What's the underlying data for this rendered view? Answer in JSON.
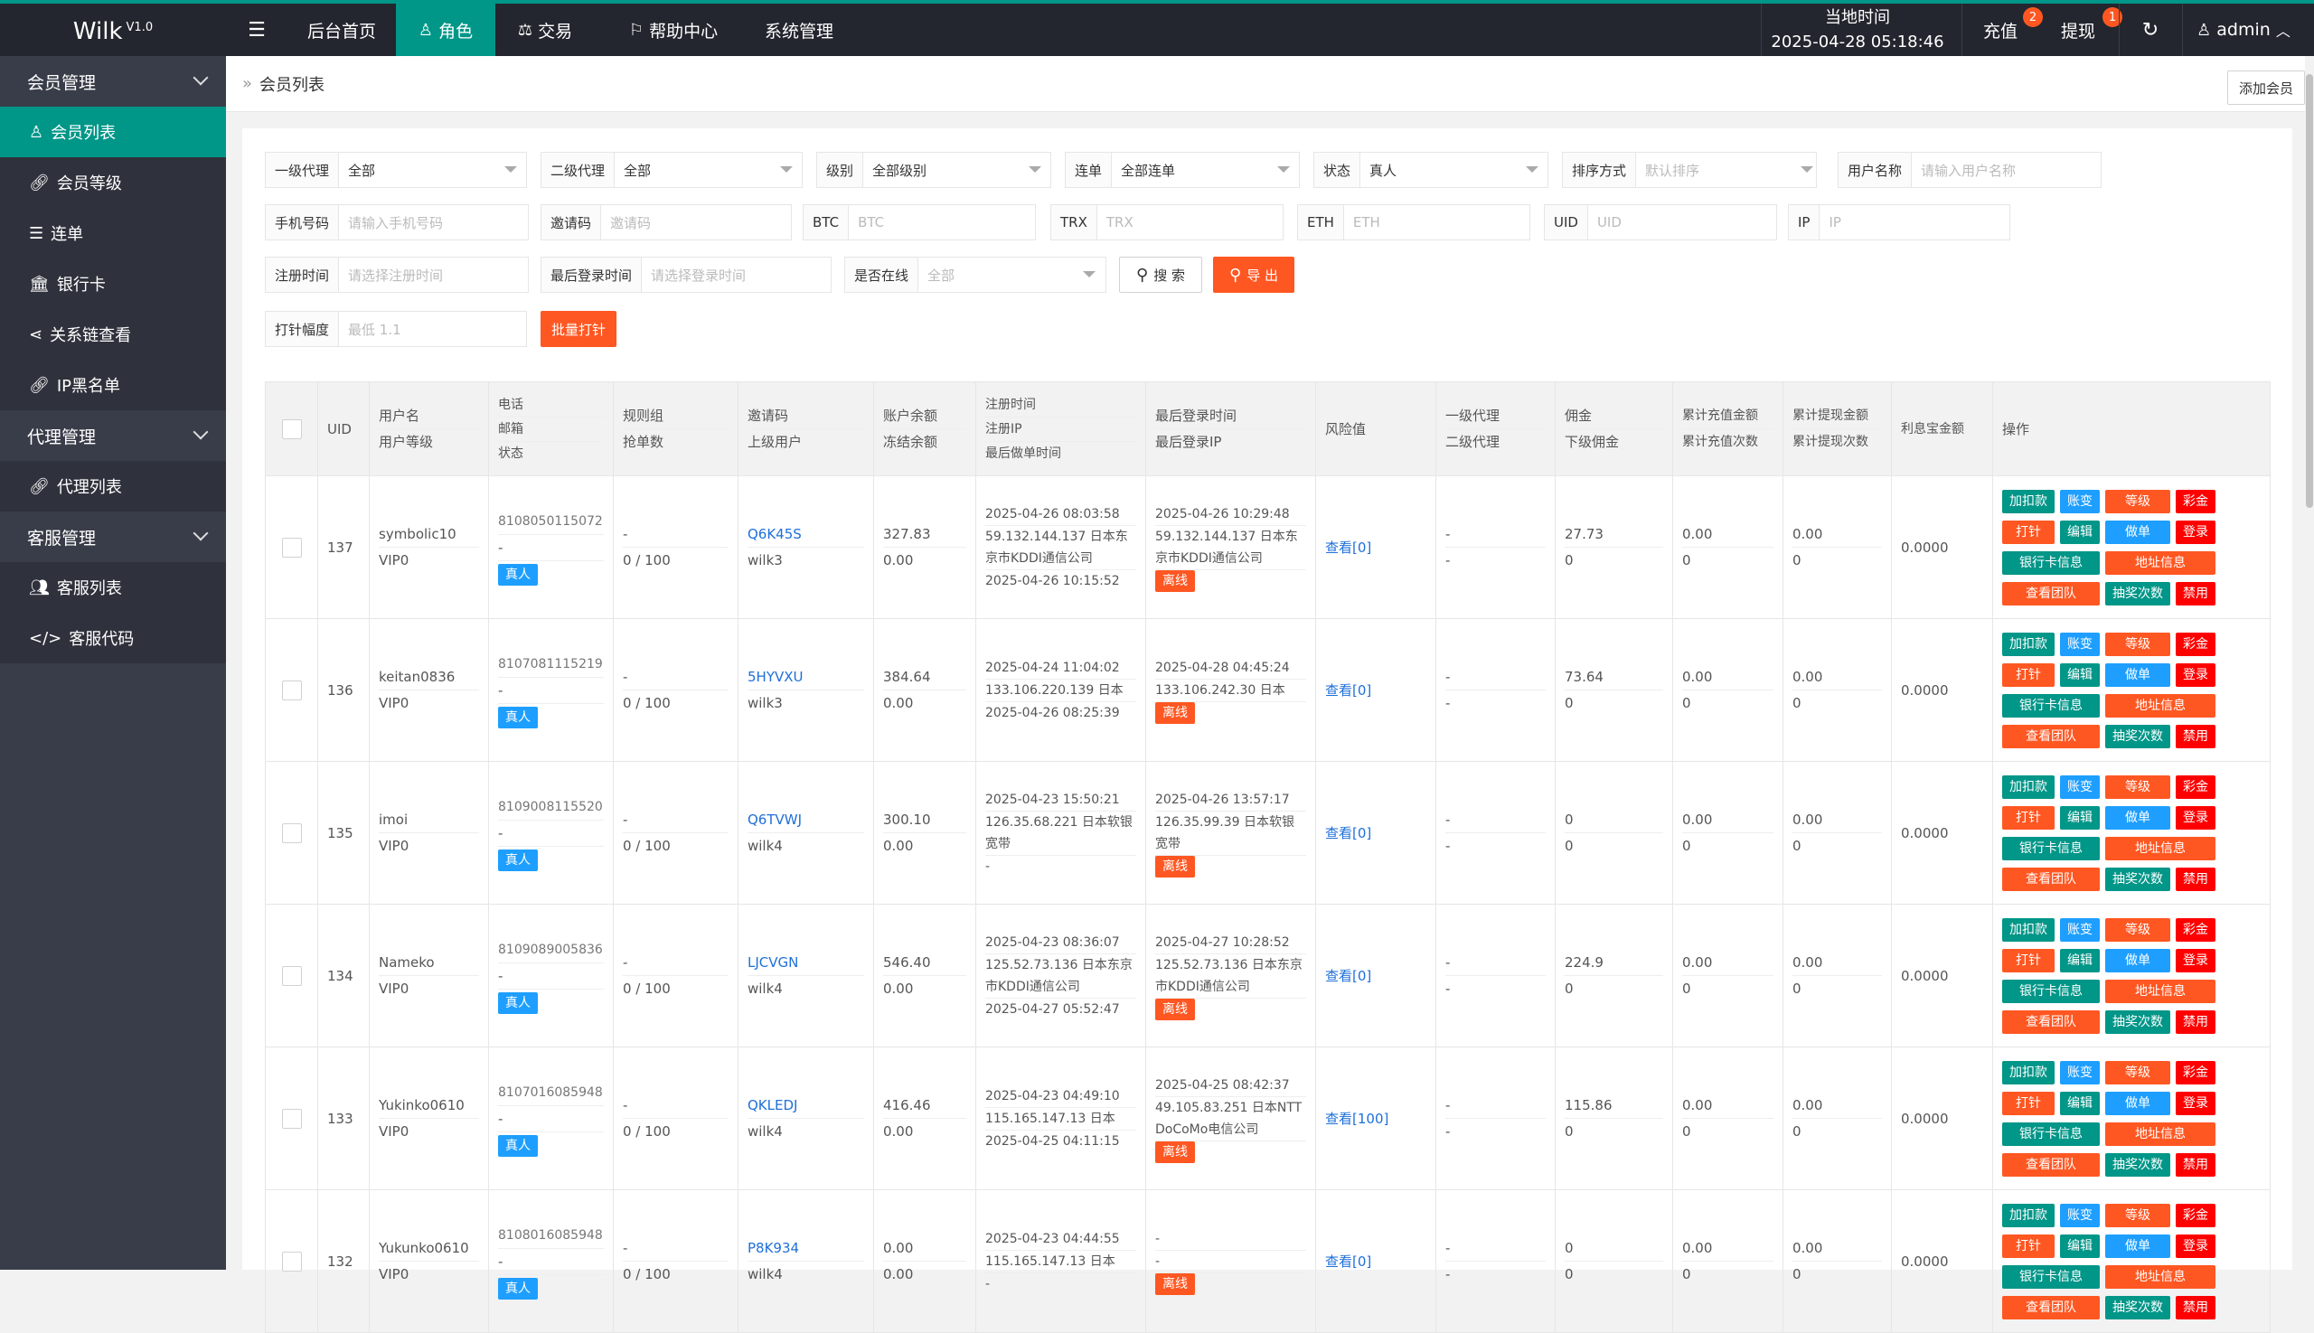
{
  "app": {
    "name": "Wilk",
    "version": "V1.0"
  },
  "topnav": {
    "menu_icon": "hamburger-icon",
    "items": [
      {
        "label": "后台首页",
        "icon": ""
      },
      {
        "label": "角色",
        "icon": "user-icon"
      },
      {
        "label": "交易",
        "icon": "scale-icon"
      },
      {
        "label": "帮助中心",
        "icon": "flag-icon"
      },
      {
        "label": "系统管理",
        "icon": ""
      }
    ],
    "time_label": "当地时间",
    "time_value": "2025-04-28 05:18:46",
    "recharge": {
      "label": "充值",
      "badge": "2"
    },
    "withdraw": {
      "label": "提现",
      "badge": "1"
    },
    "refresh_icon": "refresh-icon",
    "user": "admin"
  },
  "sidebar": {
    "groups": [
      {
        "label": "会员管理",
        "items": [
          {
            "label": "会员列表",
            "icon": "user-icon"
          },
          {
            "label": "会员等级",
            "icon": "link-icon"
          },
          {
            "label": "连单",
            "icon": "list-icon"
          },
          {
            "label": "银行卡",
            "icon": "bank-icon"
          },
          {
            "label": "关系链查看",
            "icon": "share-icon"
          },
          {
            "label": "IP黑名单",
            "icon": "link-icon"
          }
        ]
      },
      {
        "label": "代理管理",
        "items": [
          {
            "label": "代理列表",
            "icon": "link-icon"
          }
        ]
      },
      {
        "label": "客服管理",
        "items": [
          {
            "label": "客服列表",
            "icon": "users-icon"
          },
          {
            "label": "客服代码",
            "icon": "code-icon"
          }
        ]
      }
    ]
  },
  "breadcrumb": {
    "current": "会员列表"
  },
  "add_member": "添加会员",
  "filters": {
    "agent1": {
      "label": "一级代理",
      "value": "全部"
    },
    "agent2": {
      "label": "二级代理",
      "value": "全部"
    },
    "level": {
      "label": "级别",
      "value": "全部级别"
    },
    "chain": {
      "label": "连单",
      "value": "全部连单"
    },
    "status": {
      "label": "状态",
      "value": "真人"
    },
    "sort": {
      "label": "排序方式",
      "placeholder": "默认排序"
    },
    "username": {
      "label": "用户名称",
      "placeholder": "请输入用户名称"
    },
    "phone": {
      "label": "手机号码",
      "placeholder": "请输入手机号码"
    },
    "invite": {
      "label": "邀请码",
      "placeholder": "邀请码"
    },
    "btc": {
      "label": "BTC",
      "placeholder": "BTC"
    },
    "trx": {
      "label": "TRX",
      "placeholder": "TRX"
    },
    "eth": {
      "label": "ETH",
      "placeholder": "ETH"
    },
    "uid": {
      "label": "UID",
      "placeholder": "UID"
    },
    "ip": {
      "label": "IP",
      "placeholder": "IP"
    },
    "regtime": {
      "label": "注册时间",
      "placeholder": "请选择注册时间"
    },
    "logintime": {
      "label": "最后登录时间",
      "placeholder": "请选择登录时间"
    },
    "online": {
      "label": "是否在线",
      "placeholder": "全部"
    },
    "search_btn": "搜 索",
    "export_btn": "导 出",
    "amp": {
      "label": "打针幅度",
      "placeholder": "最低 1.1"
    },
    "batch_btn": "批量打针"
  },
  "table": {
    "headers": {
      "uid": "UID",
      "user": [
        "用户名",
        "用户等级"
      ],
      "contact": [
        "电话",
        "邮箱",
        "状态"
      ],
      "rule": [
        "规则组",
        "抢单数"
      ],
      "invite": [
        "邀请码",
        "上级用户"
      ],
      "balance": [
        "账户余额",
        "冻结余额"
      ],
      "reg": [
        "注册时间",
        "注册IP",
        "最后做单时间"
      ],
      "login": [
        "最后登录时间",
        "最后登录IP"
      ],
      "risk": "风险值",
      "agent": [
        "一级代理",
        "二级代理"
      ],
      "commission": [
        "佣金",
        "下级佣金"
      ],
      "recharge": [
        "累计充值金额",
        "累计充值次数"
      ],
      "withdraw": [
        "累计提现金额",
        "累计提现次数"
      ],
      "interest": "利息宝金额",
      "ops": "操作"
    },
    "actions": [
      "加扣款",
      "账变",
      "等级",
      "彩金",
      "打针",
      "编辑",
      "做单",
      "登录",
      "银行卡信息",
      "地址信息",
      "查看团队",
      "抽奖次数",
      "禁用"
    ],
    "rows": [
      {
        "uid": "137",
        "username": "symbolic10",
        "level": "VIP0",
        "phone": "8108050115072",
        "email": "-",
        "status": "真人",
        "rule": "-",
        "grab": "0 / 100",
        "code": "Q6K45S",
        "parent": "wilk3",
        "bal": "327.83",
        "frozen": "0.00",
        "reg_time": "2025-04-26 08:03:58",
        "reg_ip": "59.132.144.137 日本东京市KDDI通信公司",
        "last_order": "2025-04-26 10:15:52",
        "login_time": "2025-04-26 10:29:48",
        "login_ip": "59.132.144.137 日本东京市KDDI通信公司",
        "online": "离线",
        "risk": "查看[0]",
        "ag1": "-",
        "ag2": "-",
        "comm": "27.73",
        "sub_comm": "0",
        "rc_amt": "0.00",
        "rc_cnt": "0",
        "wd_amt": "0.00",
        "wd_cnt": "0",
        "interest": "0.0000"
      },
      {
        "uid": "136",
        "username": "keitan0836",
        "level": "VIP0",
        "phone": "8107081115219",
        "email": "-",
        "status": "真人",
        "rule": "-",
        "grab": "0 / 100",
        "code": "5HYVXU",
        "parent": "wilk3",
        "bal": "384.64",
        "frozen": "0.00",
        "reg_time": "2025-04-24 11:04:02",
        "reg_ip": "133.106.220.139 日本",
        "last_order": "2025-04-26 08:25:39",
        "login_time": "2025-04-28 04:45:24",
        "login_ip": "133.106.242.30 日本",
        "online": "离线",
        "risk": "查看[0]",
        "ag1": "-",
        "ag2": "-",
        "comm": "73.64",
        "sub_comm": "0",
        "rc_amt": "0.00",
        "rc_cnt": "0",
        "wd_amt": "0.00",
        "wd_cnt": "0",
        "interest": "0.0000"
      },
      {
        "uid": "135",
        "username": "imoi",
        "level": "VIP0",
        "phone": "8109008115520",
        "email": "-",
        "status": "真人",
        "rule": "-",
        "grab": "0 / 100",
        "code": "Q6TVWJ",
        "parent": "wilk4",
        "bal": "300.10",
        "frozen": "0.00",
        "reg_time": "2025-04-23 15:50:21",
        "reg_ip": "126.35.68.221 日本软银宽带",
        "last_order": "-",
        "login_time": "2025-04-26 13:57:17",
        "login_ip": "126.35.99.39 日本软银宽带",
        "online": "离线",
        "risk": "查看[0]",
        "ag1": "-",
        "ag2": "-",
        "comm": "0",
        "sub_comm": "0",
        "rc_amt": "0.00",
        "rc_cnt": "0",
        "wd_amt": "0.00",
        "wd_cnt": "0",
        "interest": "0.0000"
      },
      {
        "uid": "134",
        "username": "Nameko",
        "level": "VIP0",
        "phone": "8109089005836",
        "email": "-",
        "status": "真人",
        "rule": "-",
        "grab": "0 / 100",
        "code": "LJCVGN",
        "parent": "wilk4",
        "bal": "546.40",
        "frozen": "0.00",
        "reg_time": "2025-04-23 08:36:07",
        "reg_ip": "125.52.73.136 日本东京市KDDI通信公司",
        "last_order": "2025-04-27 05:52:47",
        "login_time": "2025-04-27 10:28:52",
        "login_ip": "125.52.73.136 日本东京市KDDI通信公司",
        "online": "离线",
        "risk": "查看[0]",
        "ag1": "-",
        "ag2": "-",
        "comm": "224.9",
        "sub_comm": "0",
        "rc_amt": "0.00",
        "rc_cnt": "0",
        "wd_amt": "0.00",
        "wd_cnt": "0",
        "interest": "0.0000"
      },
      {
        "uid": "133",
        "username": "Yukinko0610",
        "level": "VIP0",
        "phone": "8107016085948",
        "email": "-",
        "status": "真人",
        "rule": "-",
        "grab": "0 / 100",
        "code": "QKLEDJ",
        "parent": "wilk4",
        "bal": "416.46",
        "frozen": "0.00",
        "reg_time": "2025-04-23 04:49:10",
        "reg_ip": "115.165.147.13 日本",
        "last_order": "2025-04-25 04:11:15",
        "login_time": "2025-04-25 08:42:37",
        "login_ip": "49.105.83.251 日本NTT DoCoMo电信公司",
        "online": "离线",
        "risk": "查看[100]",
        "ag1": "-",
        "ag2": "-",
        "comm": "115.86",
        "sub_comm": "0",
        "rc_amt": "0.00",
        "rc_cnt": "0",
        "wd_amt": "0.00",
        "wd_cnt": "0",
        "interest": "0.0000"
      },
      {
        "uid": "132",
        "username": "Yukunko0610",
        "level": "VIP0",
        "phone": "8108016085948",
        "email": "-",
        "status": "真人",
        "rule": "-",
        "grab": "0 / 100",
        "code": "P8K934",
        "parent": "wilk4",
        "bal": "0.00",
        "frozen": "0.00",
        "reg_time": "2025-04-23 04:44:55",
        "reg_ip": "115.165.147.13 日本",
        "last_order": "-",
        "login_time": "-",
        "login_ip": "-",
        "online": "离线",
        "risk": "查看[0]",
        "ag1": "-",
        "ag2": "-",
        "comm": "0",
        "sub_comm": "0",
        "rc_amt": "0.00",
        "rc_cnt": "0",
        "wd_amt": "0.00",
        "wd_cnt": "0",
        "interest": "0.0000"
      }
    ]
  },
  "colors": {
    "topbar": "#23262e",
    "sidebar": "#393d49",
    "accent": "#009688",
    "blue": "#1e9fff",
    "orange": "#ff5722",
    "red": "#ff0000"
  }
}
